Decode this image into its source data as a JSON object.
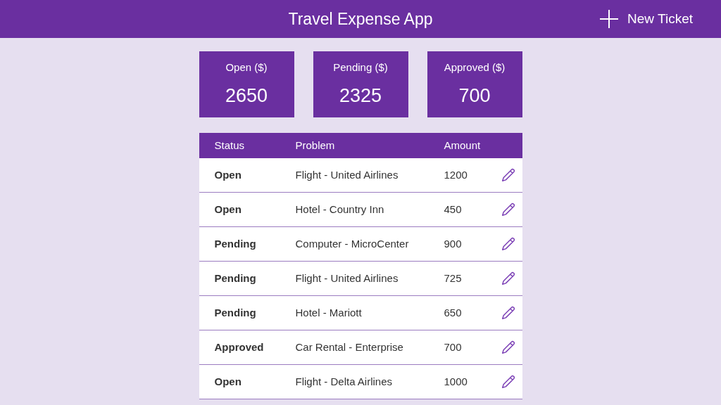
{
  "header": {
    "title": "Travel Expense App",
    "new_button": "New Ticket"
  },
  "summary": [
    {
      "label": "Open ($)",
      "value": "2650"
    },
    {
      "label": "Pending ($)",
      "value": "2325"
    },
    {
      "label": "Approved ($)",
      "value": "700"
    }
  ],
  "table": {
    "columns": [
      "Status",
      "Problem",
      "Amount"
    ],
    "rows": [
      {
        "status": "Open",
        "problem": "Flight - United Airlines",
        "amount": "1200"
      },
      {
        "status": "Open",
        "problem": "Hotel - Country Inn",
        "amount": "450"
      },
      {
        "status": "Pending",
        "problem": "Computer - MicroCenter",
        "amount": "900"
      },
      {
        "status": "Pending",
        "problem": "Flight - United Airlines",
        "amount": "725"
      },
      {
        "status": "Pending",
        "problem": "Hotel - Mariott",
        "amount": "650"
      },
      {
        "status": "Approved",
        "problem": "Car Rental - Enterprise",
        "amount": "700"
      },
      {
        "status": "Open",
        "problem": "Flight - Delta Airlines",
        "amount": "1000"
      }
    ]
  }
}
